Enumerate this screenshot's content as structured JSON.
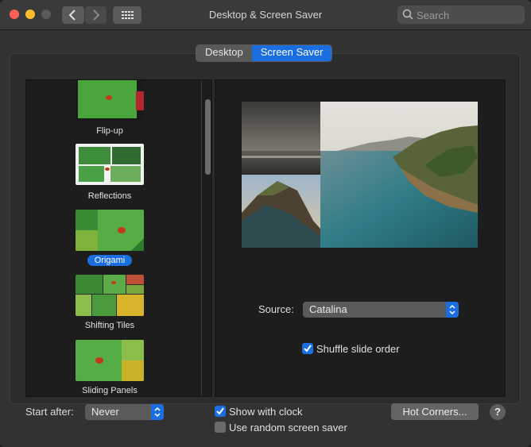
{
  "window": {
    "title": "Desktop & Screen Saver"
  },
  "search": {
    "placeholder": "Search"
  },
  "tabs": [
    {
      "label": "Desktop",
      "active": false
    },
    {
      "label": "Screen Saver",
      "active": true
    }
  ],
  "screensavers": [
    {
      "label": "Flip-up",
      "selected": false
    },
    {
      "label": "Reflections",
      "selected": false
    },
    {
      "label": "Origami",
      "selected": true
    },
    {
      "label": "Shifting Tiles",
      "selected": false
    },
    {
      "label": "Sliding Panels",
      "selected": false
    }
  ],
  "source": {
    "label": "Source:",
    "value": "Catalina"
  },
  "shuffle": {
    "label": "Shuffle slide order",
    "checked": true
  },
  "start_after": {
    "label": "Start after:",
    "value": "Never"
  },
  "show_clock": {
    "label": "Show with clock",
    "checked": true
  },
  "random": {
    "label": "Use random screen saver",
    "checked": false
  },
  "hot_corners": {
    "label": "Hot Corners..."
  },
  "help": {
    "label": "?"
  },
  "colors": {
    "accent": "#1a6ee0",
    "window_bg": "#323232",
    "panel_bg": "#1d1d1d"
  },
  "icons": [
    "chevron-left-icon",
    "chevron-right-icon",
    "grid-icon",
    "search-icon",
    "checkmark-icon",
    "up-down-chevron-icon"
  ]
}
